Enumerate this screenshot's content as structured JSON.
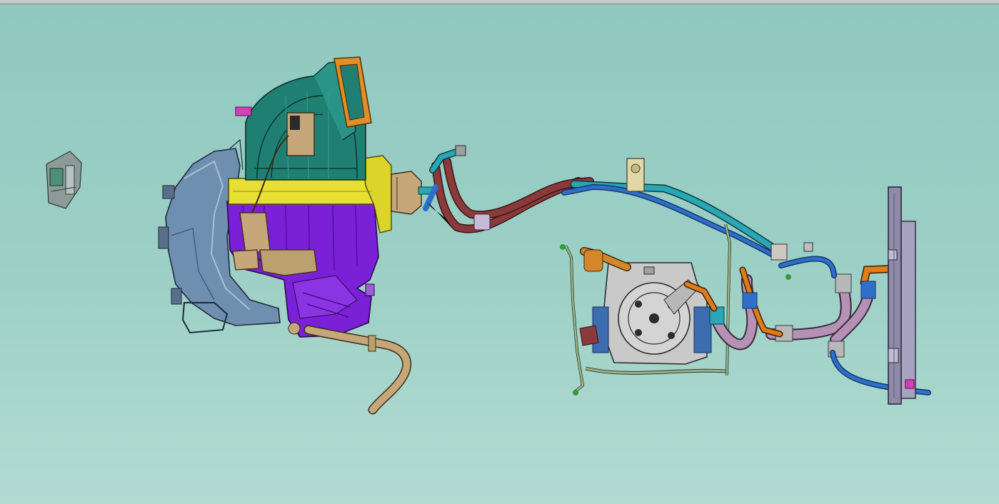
{
  "window": {
    "title": ""
  },
  "viewport": {
    "background_top": "#8fc8c0",
    "background_bottom": "#b2dbd2"
  },
  "parts": [
    {
      "id": "small-module",
      "icon": "gray-module-icon"
    },
    {
      "id": "hvac-housing",
      "icon": "housing-icon",
      "color": "#6f8fb0"
    },
    {
      "id": "blower-scroll",
      "icon": "fan-icon",
      "color": "#1f7f73"
    },
    {
      "id": "filter-frame",
      "icon": "frame-icon",
      "color": "#e0902a"
    },
    {
      "id": "evaporator-case",
      "icon": "case-icon",
      "color": "#7a20d6"
    },
    {
      "id": "heater-core-strip",
      "icon": "strip-icon",
      "color": "#e7e033"
    },
    {
      "id": "drain-hose",
      "icon": "hose-icon",
      "color": "#c6a77a"
    },
    {
      "id": "suction-line",
      "icon": "pipe-icon",
      "color": "#8a3a3a"
    },
    {
      "id": "liquid-line",
      "icon": "pipe-icon",
      "color": "#2aa6b4"
    },
    {
      "id": "compressor",
      "icon": "compressor-icon",
      "color": "#c9c9c9"
    },
    {
      "id": "compressor-bracket",
      "icon": "bracket-icon",
      "color": "#9bb38a"
    },
    {
      "id": "discharge-hose",
      "icon": "hose-icon",
      "color": "#b591b5"
    },
    {
      "id": "orange-line",
      "icon": "pipe-icon",
      "color": "#e07c1a"
    },
    {
      "id": "blue-line",
      "icon": "pipe-icon",
      "color": "#2f6fc9"
    },
    {
      "id": "condenser-receiver",
      "icon": "receiver-icon",
      "color": "#8e8aa8"
    }
  ]
}
